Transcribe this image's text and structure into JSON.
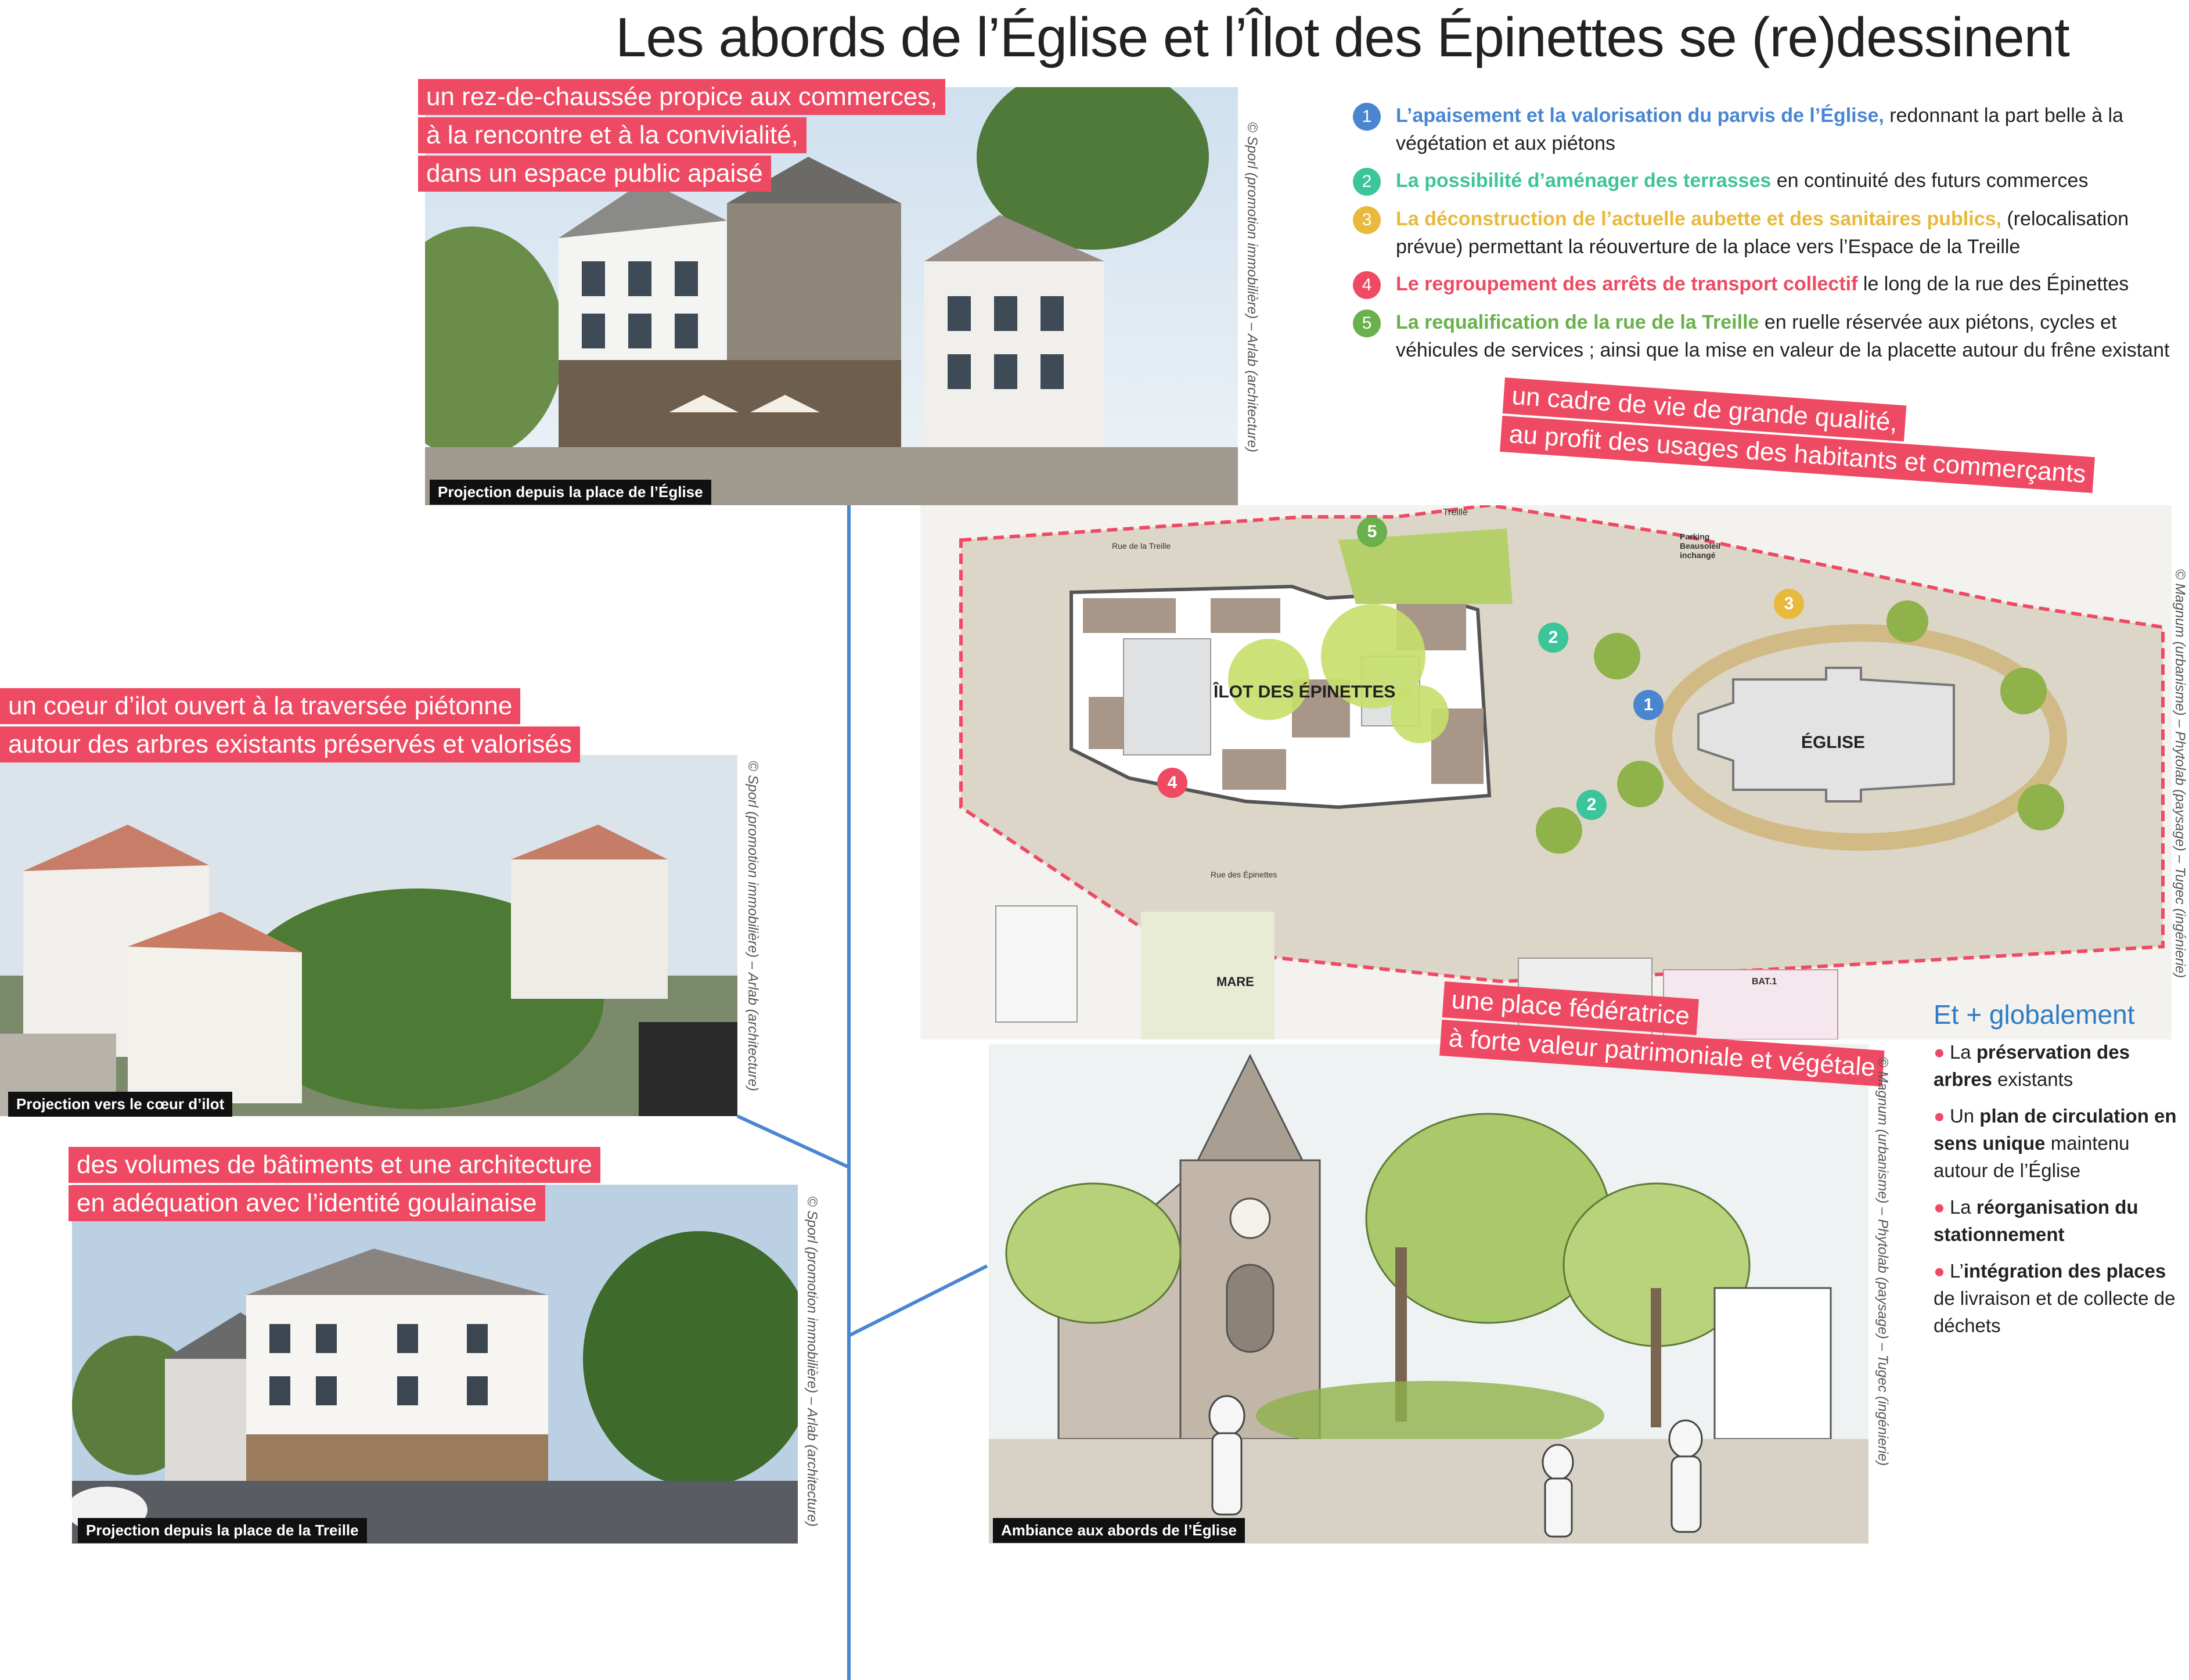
{
  "title": "Les abords de l’Église et l’Îlot des Épinettes se (re)dessinent",
  "legend": [
    {
      "num": "1",
      "color": "#4a86d0",
      "highlight": "L’apaisement et la valorisation du parvis de l’Église,",
      "text": " redonnant la part belle à la végétation et aux piétons"
    },
    {
      "num": "2",
      "color": "#3cc49a",
      "highlight": "La possibilité d’aménager des terrasses",
      "text": " en continuité des futurs commerces"
    },
    {
      "num": "3",
      "color": "#e8b93c",
      "highlight": "La déconstruction de l’actuelle aubette et des sanitaires publics,",
      "text": " (relocalisation prévue) permettant la réouverture de la place vers l’Espace de la Treille"
    },
    {
      "num": "4",
      "color": "#ef4a63",
      "highlight": "Le regroupement des arrêts de transport collectif",
      "text": " le long de la rue des Épinettes"
    },
    {
      "num": "5",
      "color": "#6ab04c",
      "highlight": "La requalification de la rue de la Treille",
      "text": " en ruelle réservée aux piétons, cycles et véhicules de services ; ainsi que la mise en valeur de la placette autour du frêne existant"
    }
  ],
  "banners": {
    "top_left": [
      "un rez-de-chaussée propice aux commerces,",
      "à la rencontre et à la convivialité,",
      "dans un espace public apaisé"
    ],
    "mid_left": [
      "un coeur d’ilot ouvert à la traversée piétonne",
      "autour des arbres existants préservés et valorisés"
    ],
    "bottom_left": [
      "des volumes de bâtiments et une architecture",
      "en adéquation avec l’identité goulainaise"
    ],
    "plan": [
      "un cadre de vie de grande qualité,",
      "au profit des usages des habitants et commerçants"
    ],
    "sketch": [
      "une place fédératrice",
      "à forte valeur patrimoniale et végétale"
    ]
  },
  "captions": {
    "top": "Projection depuis la place de l’Église",
    "mid": "Projection vers le cœur d’ilot",
    "bottom": "Projection depuis la place de la Treille",
    "sketch": "Ambiance aux abords de l’Église"
  },
  "credits": {
    "sporl": "© Sporl (promotion immobilière) – Arlab (architecture)",
    "magnum": "© Magnum (urbanisme) – Phytolab (paysage) – Tugec (ingénierie)"
  },
  "plan_labels": {
    "ilot": "ÎLOT DES ÉPINETTES",
    "eglise": "ÉGLISE",
    "mare": "MARE",
    "placette": "Placette de la Treille",
    "rue_treille": "Rue de la Treille",
    "rue_epinettes": "Rue des Épinettes",
    "parking": "Parking Beausoleil inchangé",
    "bat": "BAT.1"
  },
  "global": {
    "heading": "Et + globalement",
    "items": [
      {
        "pre": "La ",
        "bold": "préservation des arbres",
        "post": " existants"
      },
      {
        "pre": "Un ",
        "bold": "plan de circulation en sens unique",
        "post": " maintenu autour de l’Église"
      },
      {
        "pre": "La ",
        "bold": "réorganisation du stationnement",
        "post": ""
      },
      {
        "pre": "L’",
        "bold": "intégration des places",
        "post": " de livraison et de collecte de déchets"
      }
    ]
  },
  "colors": {
    "accent_pink": "#ef4a63",
    "accent_blue": "#2f7cc4",
    "line_blue": "#4a86d0"
  }
}
